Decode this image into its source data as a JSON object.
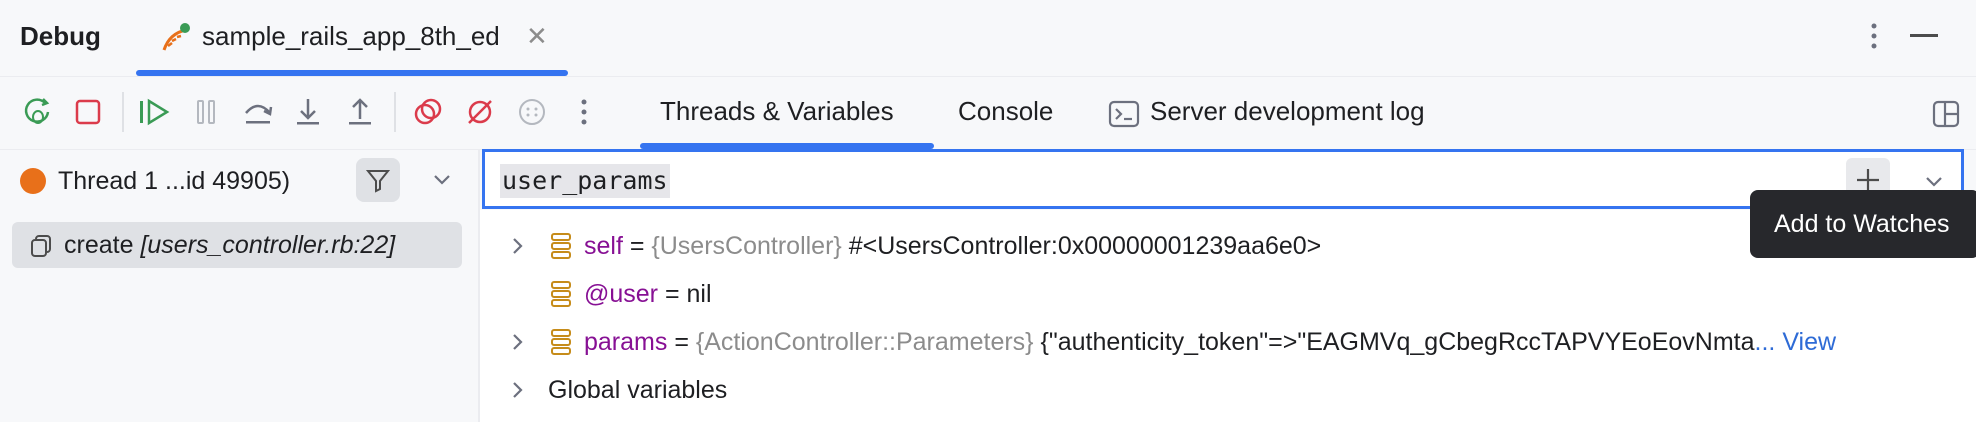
{
  "header": {
    "title": "Debug",
    "tab_label": "sample_rails_app_8th_ed",
    "tab_close": "✕"
  },
  "toolbar": {
    "icons": [
      "rerun-debug-icon",
      "stop-icon",
      "resume-icon",
      "pause-icon",
      "step-over-icon",
      "step-into-icon",
      "step-out-icon",
      "view-breakpoints-icon",
      "mute-breakpoints-icon",
      "more-debug-icon",
      "more-vertical-icon"
    ],
    "tabs": [
      {
        "label": "Threads & Variables",
        "active": true
      },
      {
        "label": "Console",
        "active": false
      },
      {
        "label": "Server development log",
        "active": false
      }
    ]
  },
  "threads": {
    "thread_label": "Thread 1 ...id 49905)",
    "frame_label_prefix": "create ",
    "frame_label_location": "[users_controller.rb:22]"
  },
  "evaluate": {
    "expression": "user_params",
    "tooltip": "Add to Watches"
  },
  "variables": [
    {
      "name": "self",
      "eq": " = ",
      "type": "{UsersController}",
      "value": " #<UsersController:0x00000001239aa6e0>",
      "expandable": true
    },
    {
      "name": "@user",
      "eq": " = ",
      "type": "",
      "value": "nil",
      "expandable": false
    },
    {
      "name": "params",
      "eq": " = ",
      "type": "{ActionController::Parameters}",
      "value": " {\"authenticity_token\"=>\"EAGMVq_gCbegRccTAPVYEoEovNmta",
      "link": "... View",
      "expandable": true
    }
  ],
  "global_label": "Global variables",
  "colors": {
    "accent": "#3574f0",
    "thread_dot": "#e8701a",
    "stop": "#db3b4b",
    "resume": "#3a9b55"
  }
}
